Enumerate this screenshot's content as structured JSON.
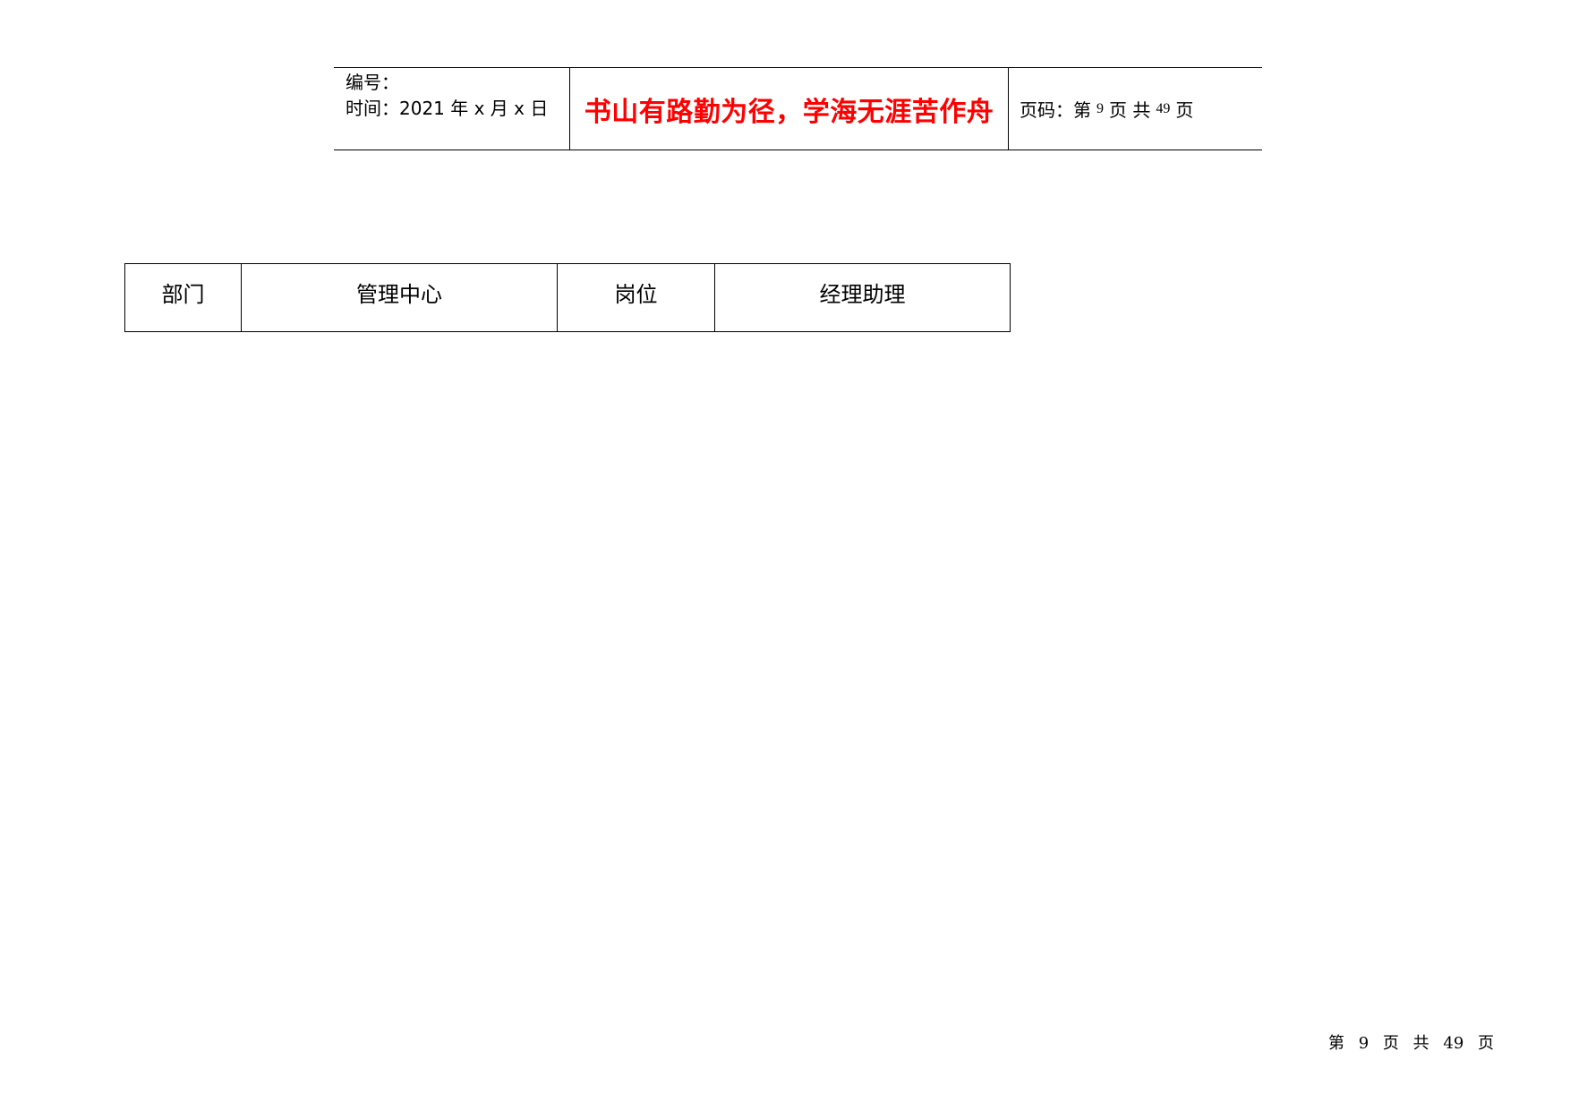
{
  "header": {
    "number_label": "编号：",
    "time_label": "时间：2021 年 x 月 x 日",
    "motto": "书山有路勤为径，学海无涯苦作舟",
    "page_prefix": "页码：第",
    "page_current": "9",
    "page_middle": "页  共",
    "page_total": "49",
    "page_suffix": "页"
  },
  "info_table": {
    "dept_label": "部门",
    "dept_value": "管理中心",
    "post_label": "岗位",
    "post_value": "经理助理"
  },
  "footer": {
    "prefix": "第",
    "current": "9",
    "middle1": "页",
    "middle2": "共",
    "total": "49",
    "suffix": "页"
  }
}
